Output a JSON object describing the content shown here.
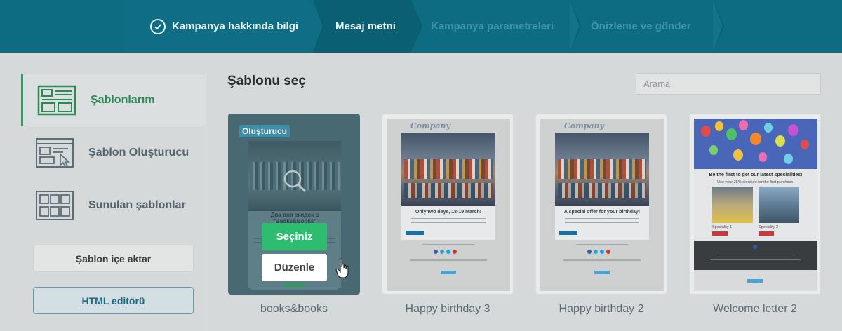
{
  "wizard": {
    "steps": [
      {
        "label": "Kampanya hakkında bilgi",
        "state": "done"
      },
      {
        "label": "Mesaj metni",
        "state": "active"
      },
      {
        "label": "Kampanya parametreleri",
        "state": "pending"
      },
      {
        "label": "Önizleme ve gönder",
        "state": "pending"
      }
    ]
  },
  "sidebar": {
    "items": [
      {
        "label": "Şablonlarım",
        "icon": "my-templates-icon",
        "active": true
      },
      {
        "label": "Şablon Oluşturucu",
        "icon": "template-builder-icon",
        "active": false
      },
      {
        "label": "Sunulan şablonlar",
        "icon": "template-gallery-icon",
        "active": false
      }
    ],
    "import_label": "Şablon içe aktar",
    "html_editor_label": "HTML editörü"
  },
  "main": {
    "title": "Şablonu seç",
    "search_placeholder": "Arama"
  },
  "templates": [
    {
      "name": "books&books",
      "badge": "Oluşturucu",
      "select_label": "Seçiniz",
      "edit_label": "Düzenle",
      "preview_heading": "Два дня скидок в \"Books&Books\""
    },
    {
      "name": "Happy birthday 3",
      "preview_logo": "Company",
      "preview_heading": "Only two days, 18-19 March!"
    },
    {
      "name": "Happy birthday 2",
      "preview_logo": "Company",
      "preview_heading": "A special offer for your birthday!"
    },
    {
      "name": "Welcome letter 2",
      "preview_heading": "Be the first to get our latest specialities!",
      "preview_sub": "Use your 25% discount for the first purchase.",
      "preview_caption_1": "Speciality 1",
      "preview_caption_2": "Speciality 2"
    }
  ],
  "colors": {
    "header_bg": "#0d6c82",
    "accent_green": "#2dbc70",
    "active_green": "#2d8a57",
    "link_blue": "#1a6a86"
  }
}
